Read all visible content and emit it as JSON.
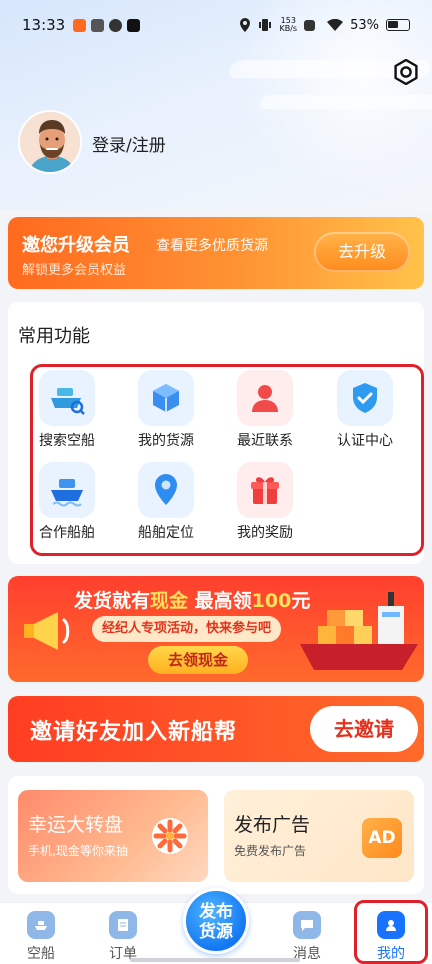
{
  "status_bar": {
    "time": "13:33",
    "network_speed_value": "153",
    "network_speed_unit": "KB/s",
    "battery": "53%"
  },
  "profile": {
    "login_label": "登录/注册"
  },
  "upgrade_banner": {
    "title": "邀您升级会员",
    "subtitle": "查看更多优质货源",
    "desc": "解锁更多会员权益",
    "button": "去升级"
  },
  "common_functions": {
    "title": "常用功能",
    "items": [
      {
        "label": "搜索空船",
        "icon": "ship-search-icon"
      },
      {
        "label": "我的货源",
        "icon": "cargo-box-icon"
      },
      {
        "label": "最近联系",
        "icon": "contact-person-icon"
      },
      {
        "label": "认证中心",
        "icon": "shield-check-icon"
      },
      {
        "label": "合作船舶",
        "icon": "ship-icon"
      },
      {
        "label": "船舶定位",
        "icon": "location-pin-icon"
      },
      {
        "label": "我的奖励",
        "icon": "gift-icon"
      }
    ]
  },
  "cash_banner": {
    "headline_prefix": "发货就有",
    "headline_gold": "现金",
    "headline_mid": " 最高领",
    "headline_amount": "100",
    "headline_suffix": "元",
    "sub": "经纪人专项活动，快来参与吧",
    "cta": "去领现金"
  },
  "invite_banner": {
    "text": "邀请好友加入新船帮",
    "button": "去邀请"
  },
  "promos": {
    "left": {
      "title": "幸运大转盘",
      "sub": "手机,现金等你来抽"
    },
    "right": {
      "title": "发布广告",
      "sub": "免费发布广告",
      "badge": "AD"
    }
  },
  "tabbar": {
    "tabs": [
      {
        "label": "空船"
      },
      {
        "label": "订单"
      },
      {
        "label": "消息"
      },
      {
        "label": "我的"
      }
    ],
    "publish_line1": "发布",
    "publish_line2": "货源",
    "active_tab": "我的"
  },
  "colors": {
    "accent_blue": "#1a73ff",
    "highlight_red": "#e0202a",
    "orange": "#ff8a1c"
  }
}
